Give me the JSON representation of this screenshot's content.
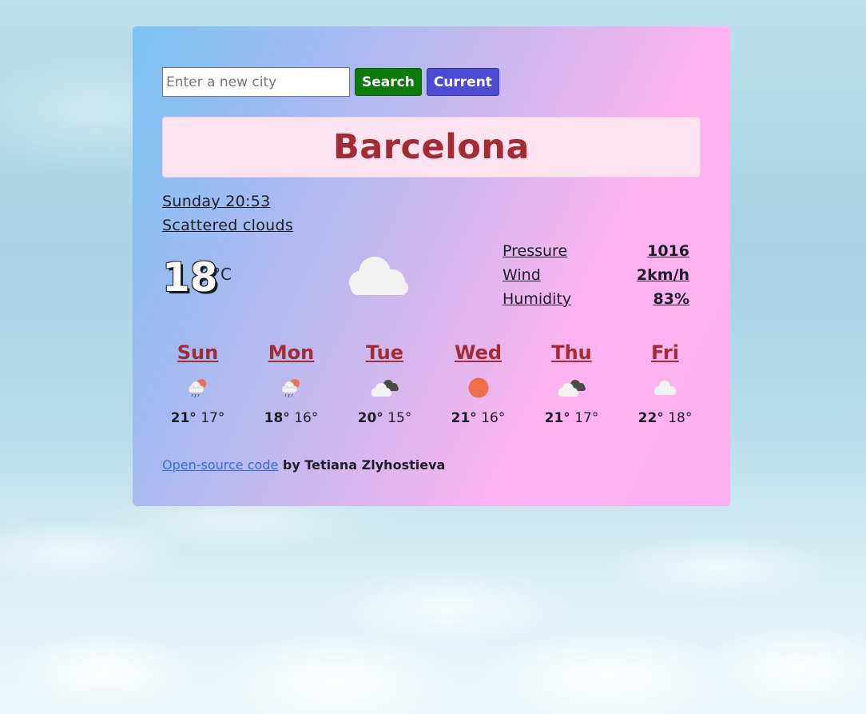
{
  "search": {
    "placeholder": "Enter a new city",
    "search_label": "Search",
    "current_label": "Current"
  },
  "city": "Barcelona",
  "current": {
    "date": "Sunday 20:53",
    "description": "Scattered clouds",
    "temperature": "18",
    "unit": "°C",
    "icon": "cloud-icon"
  },
  "details": [
    {
      "label": "Pressure",
      "value": "1016"
    },
    {
      "label": "Wind",
      "value": "2km/h"
    },
    {
      "label": "Humidity",
      "value": "83%"
    }
  ],
  "forecast": [
    {
      "day": "Sun",
      "max": "21°",
      "min": "17°",
      "icon": "rain-sun-icon"
    },
    {
      "day": "Mon",
      "max": "18°",
      "min": "16°",
      "icon": "rain-sun-icon"
    },
    {
      "day": "Tue",
      "max": "20°",
      "min": "15°",
      "icon": "broken-clouds-icon"
    },
    {
      "day": "Wed",
      "max": "21°",
      "min": "16°",
      "icon": "sun-icon"
    },
    {
      "day": "Thu",
      "max": "21°",
      "min": "17°",
      "icon": "broken-clouds-icon"
    },
    {
      "day": "Fri",
      "max": "22°",
      "min": "18°",
      "icon": "cloud-icon"
    }
  ],
  "footer": {
    "link_text": "Open-source code",
    "author_text": " by Tetiana Zlyhostieva"
  },
  "colors": {
    "city_name": "#a32b33",
    "search_button": "#0c7a0c",
    "current_button": "#4b4bd3",
    "link": "#2f6fe0",
    "sun": "#ef6e4a"
  }
}
